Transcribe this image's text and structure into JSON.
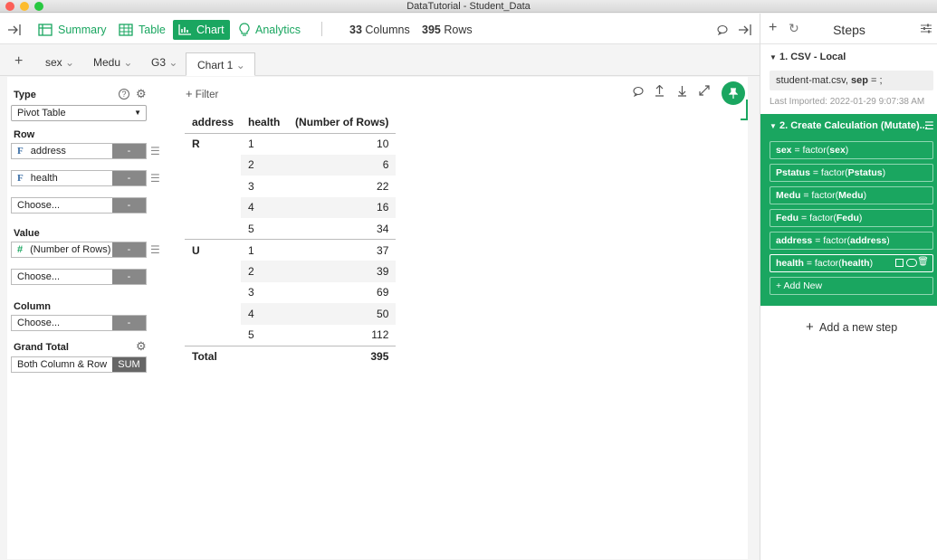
{
  "window": {
    "title": "DataTutorial - Student_Data"
  },
  "toolbar": {
    "summary": "Summary",
    "table": "Table",
    "chart": "Chart",
    "analytics": "Analytics",
    "columns_count": "33",
    "columns_label": "Columns",
    "rows_count": "395",
    "rows_label": "Rows"
  },
  "tabs": {
    "add": "+",
    "items": [
      "sex",
      "Medu",
      "G3",
      "Chart 1"
    ]
  },
  "config": {
    "type_label": "Type",
    "type_value": "Pivot Table",
    "row_label": "Row",
    "row_fields": [
      "address",
      "health"
    ],
    "choose": "Choose...",
    "value_label": "Value",
    "value_field": "(Number of Rows)",
    "column_label": "Column",
    "grand_total_label": "Grand Total",
    "grand_total_value": "Both Column & Row",
    "grand_total_agg": "SUM",
    "dash": "-",
    "filter": "Filter"
  },
  "pivot": {
    "headers": [
      "address",
      "health",
      "(Number of Rows)"
    ],
    "groups": [
      {
        "key": "R",
        "rows": [
          [
            "1",
            "10"
          ],
          [
            "2",
            "6"
          ],
          [
            "3",
            "22"
          ],
          [
            "4",
            "16"
          ],
          [
            "5",
            "34"
          ]
        ]
      },
      {
        "key": "U",
        "rows": [
          [
            "1",
            "37"
          ],
          [
            "2",
            "39"
          ],
          [
            "3",
            "69"
          ],
          [
            "4",
            "50"
          ],
          [
            "5",
            "112"
          ]
        ]
      }
    ],
    "total_label": "Total",
    "total_value": "395"
  },
  "steps": {
    "title": "Steps",
    "step1": {
      "title": "1. CSV - Local",
      "detail_file": "student-mat.csv,",
      "detail_sep_key": "sep",
      "detail_sep_val": "= ;",
      "imported": "Last Imported: 2022-01-29 9:07:38 AM"
    },
    "step2": {
      "title": "2. Create Calculation (Mutate)...",
      "commands": [
        {
          "name": "sex",
          "fn": "= factor(",
          "arg": "sex",
          "close": ")"
        },
        {
          "name": "Pstatus",
          "fn": "= factor(",
          "arg": "Pstatus",
          "close": ")"
        },
        {
          "name": "Medu",
          "fn": "= factor(",
          "arg": "Medu",
          "close": ")"
        },
        {
          "name": "Fedu",
          "fn": "= factor(",
          "arg": "Fedu",
          "close": ")"
        },
        {
          "name": "address",
          "fn": "= factor(",
          "arg": "address",
          "close": ")"
        },
        {
          "name": "health",
          "fn": "= factor(",
          "arg": "health",
          "close": ")"
        }
      ],
      "add_new": "+ Add New"
    },
    "add_step": "Add a new step"
  },
  "colors": {
    "accent": "#1aa660",
    "close": "#fc5f57",
    "minimize": "#fdbc2e",
    "zoom": "#28c840"
  }
}
